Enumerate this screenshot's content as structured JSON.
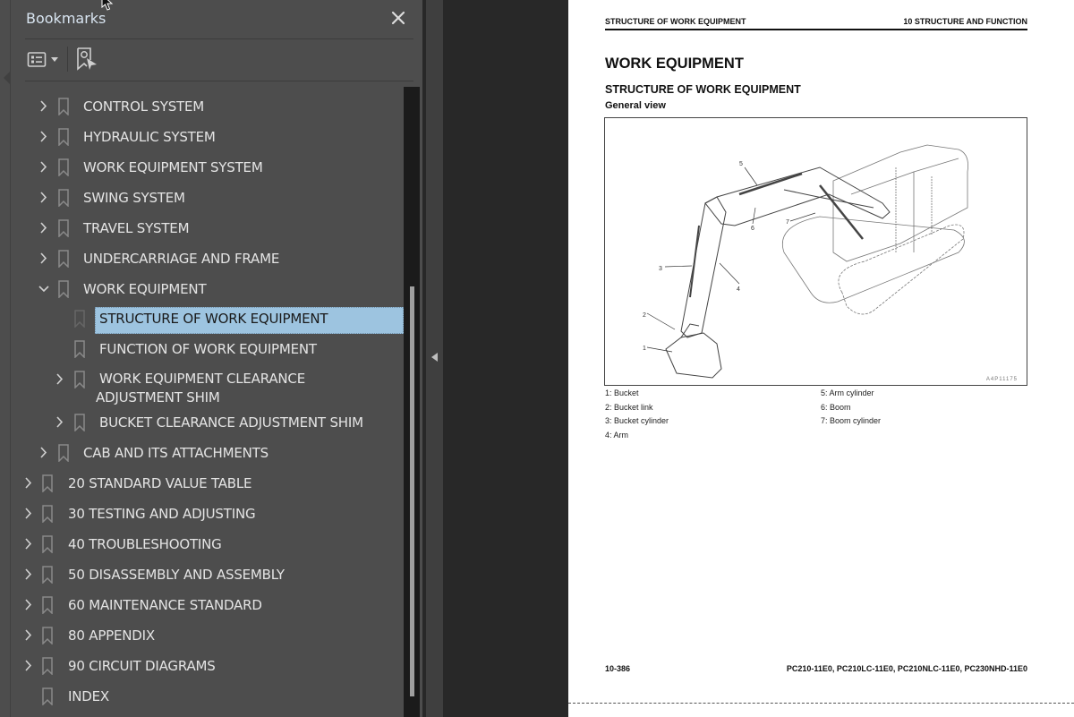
{
  "bookmarks_panel": {
    "title": "Bookmarks",
    "close_icon": "close-icon",
    "toolbar": {
      "options_icon": "list-options-icon",
      "dropdown_icon": "caret-down-icon",
      "find_bookmark_icon": "bookmark-find-icon"
    },
    "items": [
      {
        "label": "CONTROL SYSTEM",
        "level": 1,
        "expander": "collapsed"
      },
      {
        "label": "HYDRAULIC SYSTEM",
        "level": 1,
        "expander": "collapsed"
      },
      {
        "label": "WORK EQUIPMENT SYSTEM",
        "level": 1,
        "expander": "collapsed"
      },
      {
        "label": "SWING SYSTEM",
        "level": 1,
        "expander": "collapsed"
      },
      {
        "label": "TRAVEL SYSTEM",
        "level": 1,
        "expander": "collapsed"
      },
      {
        "label": "UNDERCARRIAGE AND FRAME",
        "level": 1,
        "expander": "collapsed"
      },
      {
        "label": "WORK EQUIPMENT",
        "level": 1,
        "expander": "expanded"
      },
      {
        "label": "STRUCTURE OF WORK EQUIPMENT",
        "level": 2,
        "expander": "none",
        "selected": true
      },
      {
        "label": "FUNCTION OF WORK EQUIPMENT",
        "level": 2,
        "expander": "none"
      },
      {
        "label": "WORK EQUIPMENT CLEARANCE ADJUSTMENT SHIM",
        "level": 2,
        "expander": "collapsed"
      },
      {
        "label": "BUCKET CLEARANCE ADJUSTMENT SHIM",
        "level": 2,
        "expander": "collapsed"
      },
      {
        "label": "CAB AND ITS ATTACHMENTS",
        "level": 1,
        "expander": "collapsed"
      },
      {
        "label": "20 STANDARD VALUE TABLE",
        "level": 0,
        "expander": "collapsed"
      },
      {
        "label": "30 TESTING AND ADJUSTING",
        "level": 0,
        "expander": "collapsed"
      },
      {
        "label": "40 TROUBLESHOOTING",
        "level": 0,
        "expander": "collapsed"
      },
      {
        "label": "50 DISASSEMBLY AND ASSEMBLY",
        "level": 0,
        "expander": "collapsed"
      },
      {
        "label": "60 MAINTENANCE STANDARD",
        "level": 0,
        "expander": "collapsed"
      },
      {
        "label": "80 APPENDIX",
        "level": 0,
        "expander": "collapsed"
      },
      {
        "label": "90 CIRCUIT DIAGRAMS",
        "level": 0,
        "expander": "collapsed"
      },
      {
        "label": "INDEX",
        "level": 0,
        "expander": "none"
      }
    ],
    "colors": {
      "panel_bg": "#4d4d4d",
      "selection_bg": "#9dc4e0",
      "text": "#e4e4e4"
    }
  },
  "splitter": {
    "collapse_icon": "triangle-left-icon"
  },
  "document_page": {
    "header_left": "STRUCTURE OF WORK EQUIPMENT",
    "header_right": "10 STRUCTURE AND FUNCTION",
    "heading": "WORK EQUIPMENT",
    "subheading": "STRUCTURE OF WORK EQUIPMENT",
    "section": "General view",
    "figure": {
      "code": "A4P11175",
      "callouts": [
        "1",
        "2",
        "3",
        "4",
        "5",
        "6",
        "7"
      ]
    },
    "legend_left": [
      "1: Bucket",
      "2: Bucket link",
      "3: Bucket cylinder",
      "4: Arm"
    ],
    "legend_right": [
      "5: Arm cylinder",
      "6: Boom",
      "7: Boom cylinder"
    ],
    "footer_page": "10-386",
    "footer_models": "PC210-11E0, PC210LC-11E0, PC210NLC-11E0, PC230NHD-11E0"
  }
}
